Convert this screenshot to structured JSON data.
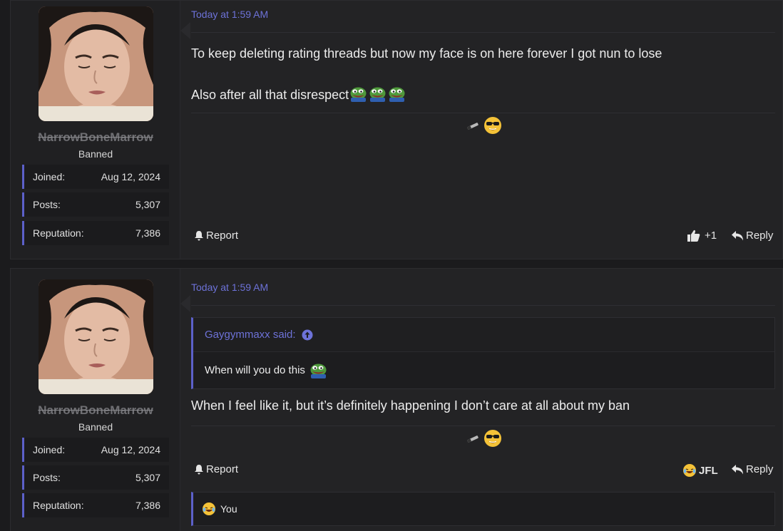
{
  "posts": [
    {
      "user": {
        "name": "NarrowBoneMarrow",
        "title": "Banned"
      },
      "stats": [
        {
          "label": "Joined:",
          "value": "Aug 12, 2024"
        },
        {
          "label": "Posts:",
          "value": "5,307"
        },
        {
          "label": "Reputation:",
          "value": "7,386"
        }
      ],
      "time": "Today at 1:59 AM",
      "message_lines": [
        "To keep deleting rating threads but now my face is on here forever I got nun to lose",
        "Also after all that disrespect"
      ],
      "actions": {
        "report": "Report",
        "like_count": "+1",
        "reply": "Reply"
      }
    },
    {
      "user": {
        "name": "NarrowBoneMarrow",
        "title": "Banned"
      },
      "stats": [
        {
          "label": "Joined:",
          "value": "Aug 12, 2024"
        },
        {
          "label": "Posts:",
          "value": "5,307"
        },
        {
          "label": "Reputation:",
          "value": "7,386"
        }
      ],
      "time": "Today at 1:59 AM",
      "quote": {
        "author": "Gaygymmaxx said:",
        "text": "When will you do this"
      },
      "message_lines": [
        "When I feel like it, but it’s definitely happening I don’t care at all about my ban"
      ],
      "actions": {
        "report": "Report",
        "reaction_label": "JFL",
        "reply": "Reply"
      },
      "reactions_summary": "You"
    }
  ],
  "icons": [
    "smoking-sunglasses-emoji",
    "pepe-laugh-emoji",
    "bell-icon",
    "thumbs-up-icon",
    "reply-icon",
    "arrow-up-circle-icon",
    "laughing-crying-emoji"
  ],
  "colors": {
    "accent": "#6d72d8",
    "stat_border": "#5c60c9",
    "background": "#1b1b1d",
    "post_bg": "#232325"
  }
}
